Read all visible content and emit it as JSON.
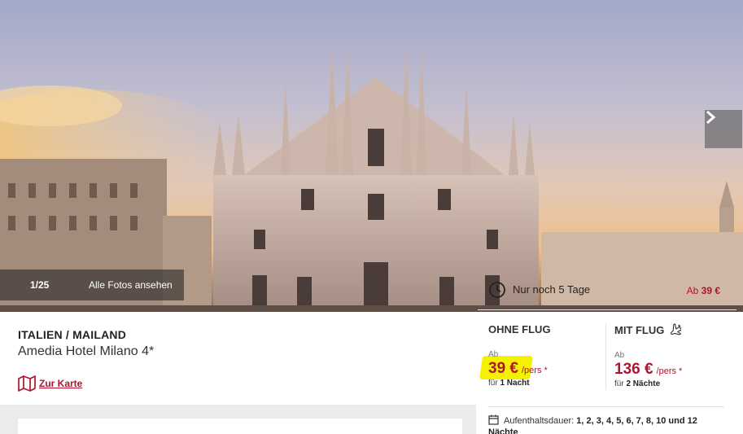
{
  "gallery": {
    "counter": "1/25",
    "all_photos_label": "Alle Fotos ansehen",
    "next_icon": "chevron-right-icon"
  },
  "hotel": {
    "breadcrumb": "ITALIEN / MAILAND",
    "name": "Amedia Hotel Milano 4*",
    "map_link": "Zur Karte",
    "map_icon": "map-icon"
  },
  "offer": {
    "urgency_text": "Nur noch 5 Tage",
    "urgency_icon": "clock-icon",
    "from_label": "Ab",
    "from_price": "39 €",
    "accent_color": "#b0142f",
    "without_flight": {
      "heading": "OHNE FLUG",
      "ab": "Ab",
      "price": "39 €",
      "per": "/pers *",
      "sub_prefix": "für",
      "sub_value": "1 Nacht"
    },
    "with_flight": {
      "heading": "MIT FLUG",
      "heading_icon": "plane-icon",
      "ab": "Ab",
      "price": "136 €",
      "per": "/pers *",
      "sub_prefix": "für",
      "sub_value": "2 Nächte"
    },
    "stay": {
      "icon": "calendar-icon",
      "label": "Aufenthaltsdauer:",
      "values": "1, 2, 3, 4, 5, 6, 7, 8, 10 und 12",
      "unit": "Nächte"
    }
  }
}
